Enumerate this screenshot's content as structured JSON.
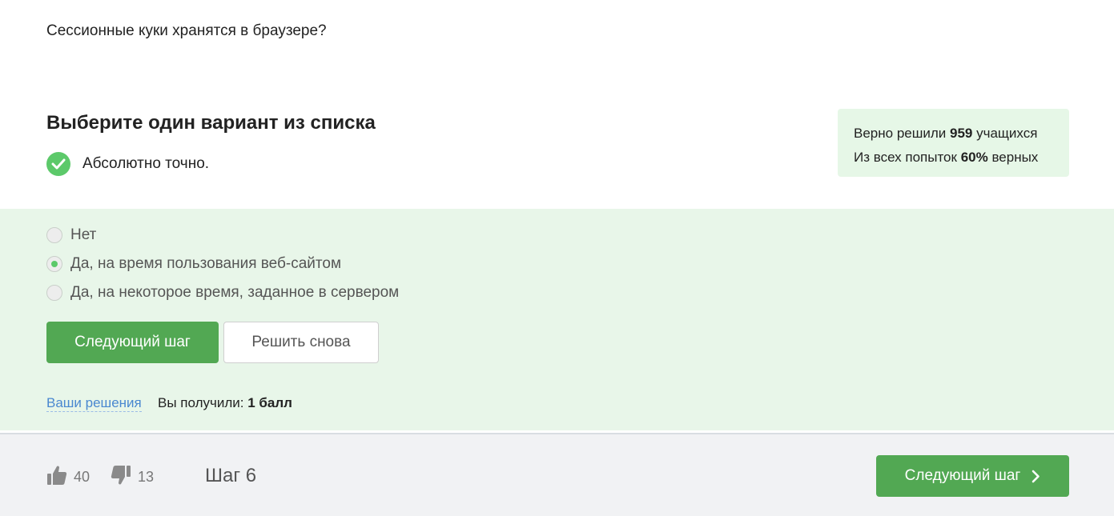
{
  "question": {
    "text": "Сессионные куки хранятся в браузере?"
  },
  "task": {
    "title": "Выберите один вариант из списка",
    "result_text": "Абсолютно точно."
  },
  "stats": {
    "line1_prefix": "Верно решили ",
    "line1_value": "959",
    "line1_suffix": " учащихся",
    "line2_prefix": "Из всех попыток ",
    "line2_value": "60%",
    "line2_suffix": " верных"
  },
  "options": [
    {
      "label": "Нет",
      "selected": false
    },
    {
      "label": "Да, на время пользования веб-сайтом",
      "selected": true
    },
    {
      "label": "Да, на некоторое время, заданное в сервером",
      "selected": false
    }
  ],
  "buttons": {
    "next_step": "Следующий шаг",
    "retry": "Решить снова"
  },
  "footer_info": {
    "solutions_link": "Ваши решения",
    "score_prefix": "Вы получили: ",
    "score_value": "1 балл"
  },
  "footer": {
    "likes": "40",
    "dislikes": "13",
    "step": "Шаг 6",
    "next_button": "Следующий шаг"
  },
  "colors": {
    "accent_green": "#52a853",
    "check_green": "#5cc96a",
    "panel_background": "#e8f6e9",
    "link_blue": "#4a88d0"
  },
  "icons": {
    "check": "check-circle-icon",
    "like": "thumbs-up-icon",
    "dislike": "thumbs-down-icon",
    "next": "chevron-right-icon"
  }
}
